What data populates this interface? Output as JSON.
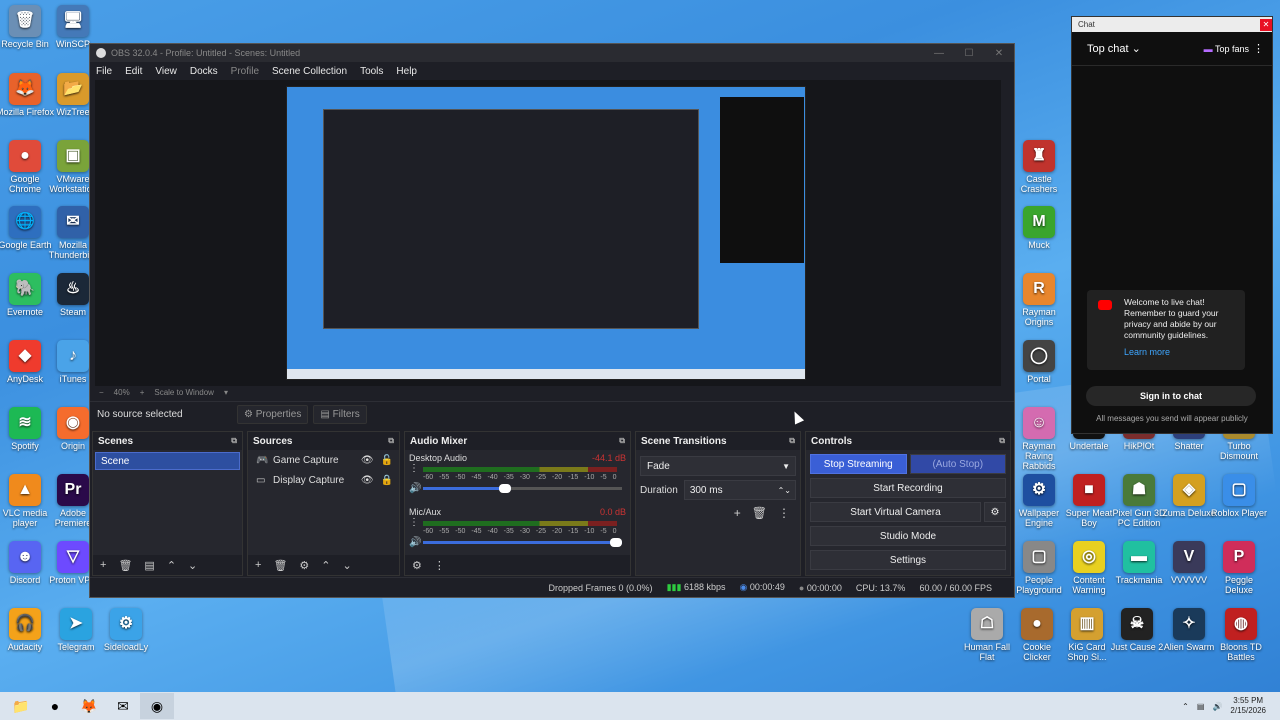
{
  "desktop": {
    "left_icons": [
      {
        "label": "Recycle Bin",
        "glyph": "🗑",
        "color": "#6b8fb5"
      },
      {
        "label": "WinSCP",
        "glyph": "🖥",
        "color": "#4479b8"
      },
      {
        "label": "Mozilla Firefox",
        "glyph": "🦊",
        "color": "#e8622b"
      },
      {
        "label": "WizTree",
        "glyph": "📂",
        "color": "#d99a2b"
      },
      {
        "label": "Google Chrome",
        "glyph": "●",
        "color": "#e04b3a"
      },
      {
        "label": "VMware Workstation",
        "glyph": "▣",
        "color": "#7aa33a"
      },
      {
        "label": "Google Earth",
        "glyph": "🌐",
        "color": "#2e6fbf"
      },
      {
        "label": "Mozilla Thunderbird",
        "glyph": "✉",
        "color": "#3061a8"
      },
      {
        "label": "Evernote",
        "glyph": "🐘",
        "color": "#2dbe60"
      },
      {
        "label": "Steam",
        "glyph": "♨",
        "color": "#1b2838"
      },
      {
        "label": "AnyDesk",
        "glyph": "◆",
        "color": "#ef3b2d"
      },
      {
        "label": "iTunes",
        "glyph": "♪",
        "color": "#4aa3e8"
      },
      {
        "label": "Spotify",
        "glyph": "≋",
        "color": "#1db954"
      },
      {
        "label": "Origin",
        "glyph": "◉",
        "color": "#f56c2d"
      },
      {
        "label": "VLC media player",
        "glyph": "▲",
        "color": "#f08a1c"
      },
      {
        "label": "Adobe Premiere",
        "glyph": "Pr",
        "color": "#2a0a4a"
      },
      {
        "label": "Discord",
        "glyph": "☻",
        "color": "#5865f2"
      },
      {
        "label": "Proton VPN",
        "glyph": "▽",
        "color": "#6d4aff"
      },
      {
        "label": "Audacity",
        "glyph": "🎧",
        "color": "#f4a21a"
      },
      {
        "label": "Telegram",
        "glyph": "➤",
        "color": "#2aa3e0"
      },
      {
        "label": "SideloadLy",
        "glyph": "⚙",
        "color": "#3ba3e8"
      }
    ],
    "top_stub_labels": [
      "WinSCP"
    ],
    "right_icons": [
      {
        "label": "Castle Crashers",
        "glyph": "♜",
        "color": "#c0332d"
      },
      {
        "label": "Muck",
        "glyph": "M",
        "color": "#3aa52d"
      },
      {
        "label": "Rayman Origins",
        "glyph": "R",
        "color": "#e8862d"
      },
      {
        "label": "Portal",
        "glyph": "◯",
        "color": "#444"
      },
      {
        "label": "Rayman Raving Rabbids",
        "glyph": "☺",
        "color": "#d46bb0"
      },
      {
        "label": "Undertale",
        "glyph": "♥",
        "color": "#111"
      },
      {
        "label": "HikPlOt",
        "glyph": "▦",
        "color": "#7a2d2d"
      },
      {
        "label": "Shatter",
        "glyph": "✦",
        "color": "#2d3f7a"
      },
      {
        "label": "Turbo Dismount",
        "glyph": "⛟",
        "color": "#aa8a2d"
      },
      {
        "label": "Wallpaper Engine",
        "glyph": "⚙",
        "color": "#1e4fa0"
      },
      {
        "label": "Super Meat Boy",
        "glyph": "■",
        "color": "#c02020"
      },
      {
        "label": "Pixel Gun 3D PC Edition",
        "glyph": "☗",
        "color": "#4a7a3a"
      },
      {
        "label": "Zuma Deluxe",
        "glyph": "◈",
        "color": "#d4a020"
      },
      {
        "label": "Roblox Player",
        "glyph": "▢",
        "color": "#3a8ee8"
      },
      {
        "label": "People Playground",
        "glyph": "▢",
        "color": "#888"
      },
      {
        "label": "Content Warning",
        "glyph": "◎",
        "color": "#e8d020"
      },
      {
        "label": "Trackmania",
        "glyph": "▬",
        "color": "#20c0a0"
      },
      {
        "label": "VVVVVV",
        "glyph": "V",
        "color": "#3a3a5a"
      },
      {
        "label": "Peggle Deluxe",
        "glyph": "P",
        "color": "#d02d5a"
      },
      {
        "label": "Human Fall Flat",
        "glyph": "☖",
        "color": "#aaa"
      },
      {
        "label": "Cookie Clicker",
        "glyph": "●",
        "color": "#a86a2d"
      },
      {
        "label": "KiG Card Shop Si...",
        "glyph": "▥",
        "color": "#d4a030"
      },
      {
        "label": "Just Cause 2",
        "glyph": "☠",
        "color": "#222"
      },
      {
        "label": "Alien Swarm",
        "glyph": "✧",
        "color": "#1a3a5a"
      },
      {
        "label": "Bloons TD Battles",
        "glyph": "◍",
        "color": "#c02020"
      }
    ]
  },
  "obs": {
    "title": "OBS 32.0.4 - Profile: Untitled - Scenes: Untitled",
    "menu": [
      "File",
      "Edit",
      "View",
      "Docks",
      "Profile",
      "Scene Collection",
      "Tools",
      "Help"
    ],
    "menu_dim_index": 4,
    "zoom": {
      "minus": "−",
      "level": "40%",
      "plus": "+",
      "mode": "Scale to Window"
    },
    "source_bar": {
      "no_source": "No source selected",
      "properties": "Properties",
      "filters": "Filters"
    },
    "scenes": {
      "title": "Scenes",
      "items": [
        "Scene"
      ]
    },
    "sources": {
      "title": "Sources",
      "items": [
        {
          "name": "Game Capture",
          "icon": "gamepad-icon",
          "glyph": "🎮"
        },
        {
          "name": "Display Capture",
          "icon": "monitor-icon",
          "glyph": "▭"
        }
      ]
    },
    "mixer": {
      "title": "Audio Mixer",
      "channels": [
        {
          "name": "Desktop Audio",
          "db": "-44.1 dB",
          "vol": 0.44
        },
        {
          "name": "Mic/Aux",
          "db": "0.0 dB",
          "vol": 1.0
        }
      ],
      "ticks": [
        "-60",
        "-55",
        "-50",
        "-45",
        "-40",
        "-35",
        "-30",
        "-25",
        "-20",
        "-15",
        "-10",
        "-5",
        "0"
      ]
    },
    "transitions": {
      "title": "Scene Transitions",
      "selected": "Fade",
      "duration_label": "Duration",
      "duration_value": "300 ms"
    },
    "controls": {
      "title": "Controls",
      "stream": "Stop Streaming",
      "auto_stop": "(Auto Stop)",
      "record": "Start Recording",
      "virtual_cam": "Start Virtual Camera",
      "studio": "Studio Mode",
      "settings": "Settings"
    },
    "status": {
      "dropped": "Dropped Frames 0 (0.0%)",
      "kbps": "6188 kbps",
      "stream_time": "00:00:49",
      "rec_time": "00:00:00",
      "cpu": "CPU: 13.7%",
      "fps": "60.00 / 60.00 FPS"
    }
  },
  "chat": {
    "window_title": "Chat",
    "header": "Top chat",
    "fans": "Top fans",
    "welcome": "Welcome to live chat! Remember to guard your privacy and abide by our community guidelines.",
    "learn_more": "Learn more",
    "sign_in": "Sign in to chat",
    "public_note": "All messages you send will appear publicly"
  },
  "taskbar": {
    "apps": [
      {
        "name": "file-explorer",
        "glyph": "📁"
      },
      {
        "name": "chrome",
        "glyph": "●"
      },
      {
        "name": "firefox",
        "glyph": "🦊"
      },
      {
        "name": "thunderbird",
        "glyph": "✉"
      },
      {
        "name": "obs",
        "glyph": "◉"
      }
    ],
    "time": "3:55 PM",
    "date": "2/15/2026"
  }
}
